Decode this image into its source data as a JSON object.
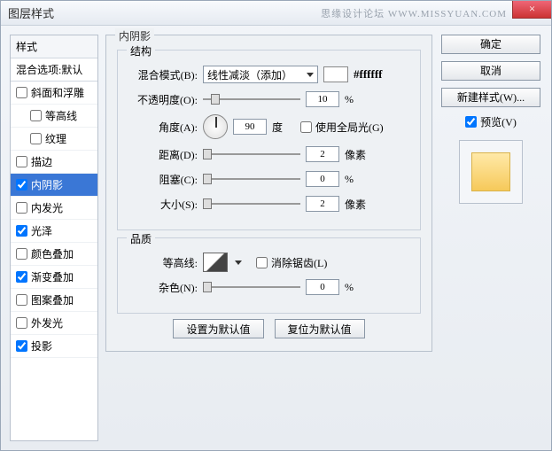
{
  "title": "图层样式",
  "watermark": "思缘设计论坛  WWW.MISSYUAN.COM",
  "close_label": "×",
  "left": {
    "header": "样式",
    "sub": "混合选项:默认",
    "items": [
      {
        "label": "斜面和浮雕",
        "checked": false,
        "indent": false
      },
      {
        "label": "等高线",
        "checked": false,
        "indent": true
      },
      {
        "label": "纹理",
        "checked": false,
        "indent": true
      },
      {
        "label": "描边",
        "checked": false,
        "indent": false
      },
      {
        "label": "内阴影",
        "checked": true,
        "indent": false,
        "selected": true
      },
      {
        "label": "内发光",
        "checked": false,
        "indent": false
      },
      {
        "label": "光泽",
        "checked": true,
        "indent": false
      },
      {
        "label": "颜色叠加",
        "checked": false,
        "indent": false
      },
      {
        "label": "渐变叠加",
        "checked": true,
        "indent": false
      },
      {
        "label": "图案叠加",
        "checked": false,
        "indent": false
      },
      {
        "label": "外发光",
        "checked": false,
        "indent": false
      },
      {
        "label": "投影",
        "checked": true,
        "indent": false
      }
    ]
  },
  "panel": {
    "title": "内阴影",
    "structure": {
      "legend": "结构",
      "blend_label": "混合模式(B):",
      "blend_value": "线性减淡（添加）",
      "hex": "#ffffff",
      "opacity_label": "不透明度(O):",
      "opacity_value": "10",
      "opacity_unit": "%",
      "angle_label": "角度(A):",
      "angle_value": "90",
      "angle_unit": "度",
      "global_label": "使用全局光(G)",
      "distance_label": "距离(D):",
      "distance_value": "2",
      "distance_unit": "像素",
      "choke_label": "阻塞(C):",
      "choke_value": "0",
      "choke_unit": "%",
      "size_label": "大小(S):",
      "size_value": "2",
      "size_unit": "像素"
    },
    "quality": {
      "legend": "品质",
      "contour_label": "等高线:",
      "aa_label": "消除锯齿(L)",
      "noise_label": "杂色(N):",
      "noise_value": "0",
      "noise_unit": "%"
    },
    "defaults_set": "设置为默认值",
    "defaults_reset": "复位为默认值"
  },
  "right": {
    "ok": "确定",
    "cancel": "取消",
    "new_style": "新建样式(W)...",
    "preview_label": "预览(V)"
  }
}
